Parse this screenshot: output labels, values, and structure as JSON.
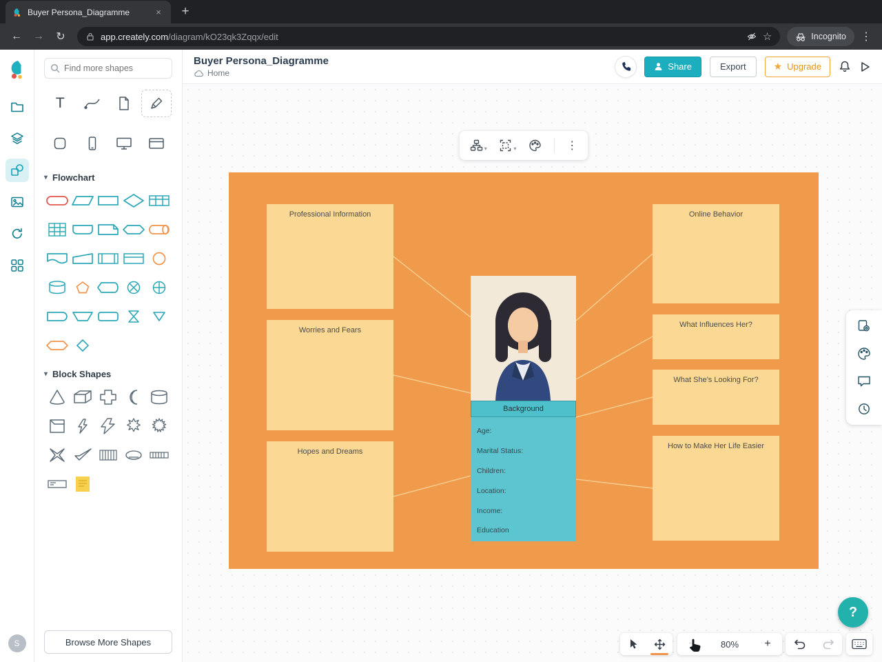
{
  "colors": {
    "accent_teal": "#1cadbe",
    "canvas_orange": "#f09a4b",
    "note_yellow": "#fbd893",
    "persona_teal": "#5cc5cf",
    "upgrade_orange": "#f1a63c",
    "help_teal": "#23b1ab"
  },
  "glyphs": {
    "close": "×",
    "new_tab": "+",
    "back": "←",
    "forward": "→",
    "reload": "↻",
    "bookmark_star": "☆",
    "menu_kebab": "⋮",
    "caret_down": "▾",
    "upgrade_star": "★",
    "zoom_in": "+",
    "zoom_out": "−",
    "help": "?",
    "text_tool": "T"
  },
  "browser": {
    "tab_title": "Buyer Persona_Diagramme",
    "url_domain": "app.creately.com",
    "url_path": "/diagram/kO23qk3Zqqx/edit",
    "incognito_label": "Incognito"
  },
  "app_header": {
    "title": "Buyer Persona_Diagramme",
    "breadcrumb_home": "Home",
    "share_label": "Share",
    "export_label": "Export",
    "upgrade_label": "Upgrade"
  },
  "shapes_panel": {
    "search_placeholder": "Find more shapes",
    "section_flowchart": "Flowchart",
    "section_block": "Block Shapes",
    "browse_more": "Browse More Shapes"
  },
  "persona": {
    "background_title": "Background",
    "fields": [
      "Age:",
      "Marital Status:",
      "Children:",
      "Location:",
      "Income:",
      "Education"
    ],
    "left_notes": [
      "Professional Information",
      "Worries and Fears",
      "Hopes and Dreams"
    ],
    "right_notes": [
      "Online Behavior",
      "What Influences Her?",
      "What She's Looking For?",
      "How to Make Her Life Easier"
    ]
  },
  "status_bar": {
    "zoom": "80%"
  },
  "account": {
    "avatar_letter": "S"
  }
}
